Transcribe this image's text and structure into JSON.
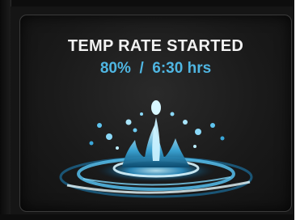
{
  "status": {
    "title": "TEMP RATE STARTED",
    "rate": "80%",
    "separator": "/",
    "duration": "6:30 hrs"
  },
  "image": {
    "icon": "water-splash-icon"
  },
  "colors": {
    "accent": "#4fb6e2",
    "title": "#f2f2f2",
    "background": "#1a1a1a"
  }
}
